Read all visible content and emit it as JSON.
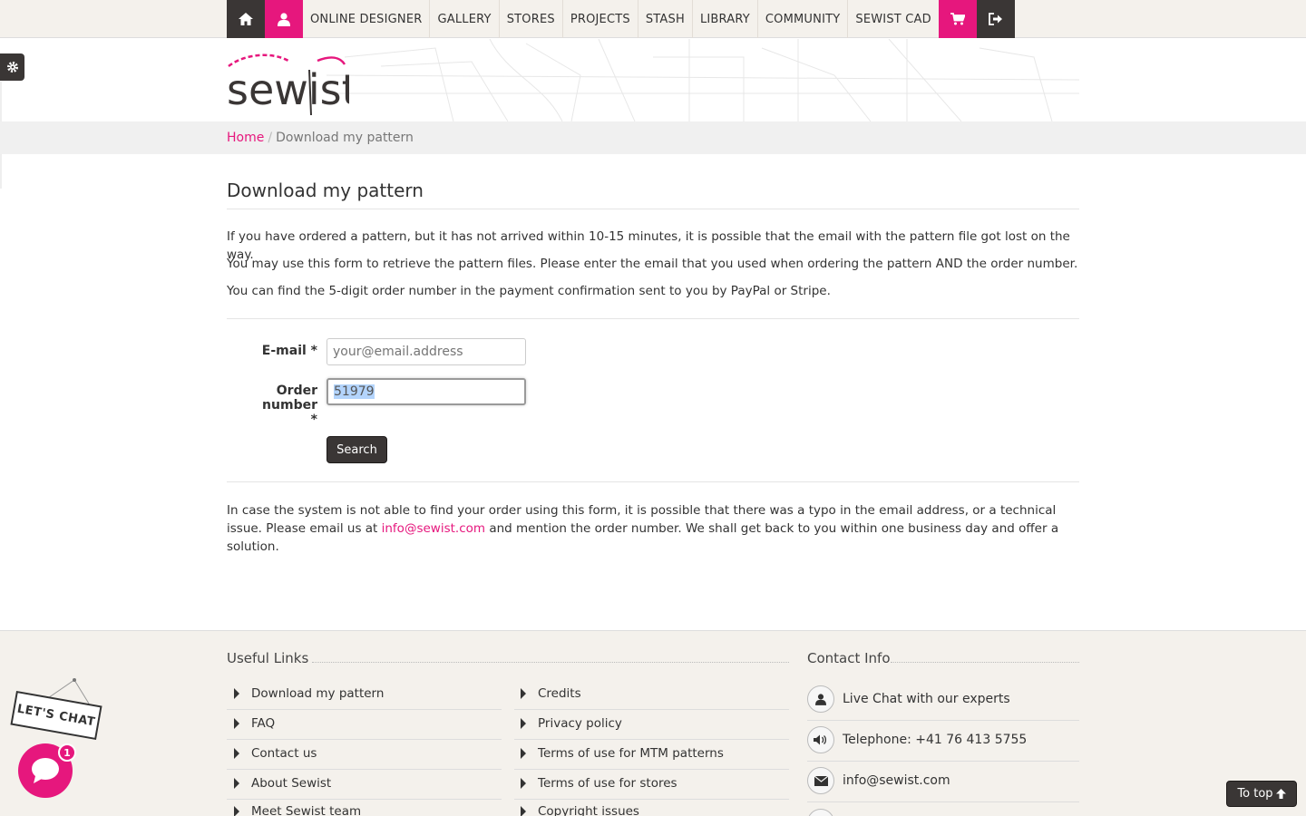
{
  "nav": {
    "items": [
      "ONLINE DESIGNER",
      "GALLERY",
      "STORES",
      "PROJECTS",
      "STASH",
      "LIBRARY",
      "COMMUNITY",
      "SEWIST CAD"
    ],
    "icons": [
      "home-icon",
      "user-icon",
      "cart-icon",
      "logout-icon"
    ]
  },
  "logo": {
    "text": "sewist"
  },
  "breadcrumb": {
    "home": "Home",
    "separator": "/",
    "current": "Download my pattern"
  },
  "page": {
    "title": "Download my pattern",
    "intro": [
      "If you have ordered a pattern, but it has not arrived within 10-15 minutes, it is possible that the email with the pattern file got lost on the way.",
      "You may use this form to retrieve the pattern files. Please enter the email that you used when ordering the pattern AND the order number.",
      "You can find the 5-digit order number in the payment confirmation sent to you by PayPal or Stripe."
    ],
    "form": {
      "email_label": "E-mail *",
      "email_placeholder": "your@email.address",
      "order_label_line1": "Order number",
      "order_label_line2": "*",
      "order_value": "51979",
      "search_label": "Search"
    },
    "footer_note_pre": "In case the system is not able to find your order using this form, it is possible that there was a typo in the email address, or a technical issue. Please email us at ",
    "footer_note_email": "info@sewist.com",
    "footer_note_post": " and mention the order number. We shall get back to you within one business day and offer a solution."
  },
  "footer": {
    "useful_links_title": "Useful Links",
    "contact_title": "Contact Info",
    "links_col1": [
      "Download my pattern",
      "FAQ",
      "Contact us",
      "About Sewist",
      "Meet Sewist team"
    ],
    "links_col2": [
      "Credits",
      "Privacy policy",
      "Terms of use for MTM patterns",
      "Terms of use for stores",
      "Copyright issues"
    ],
    "contacts": [
      {
        "icon": "user-icon",
        "text": "Live Chat with our experts"
      },
      {
        "icon": "speaker-icon",
        "text": "Telephone: +41 76 413 5755"
      },
      {
        "icon": "envelope-icon",
        "text": "info@sewist.com"
      }
    ]
  },
  "chat": {
    "sign": "LET'S CHAT",
    "badge": "1"
  },
  "totop": {
    "label": "To top"
  },
  "colors": {
    "accent": "#e6177d",
    "dark": "#3a3635",
    "footer_bg": "#f4f1ec"
  }
}
